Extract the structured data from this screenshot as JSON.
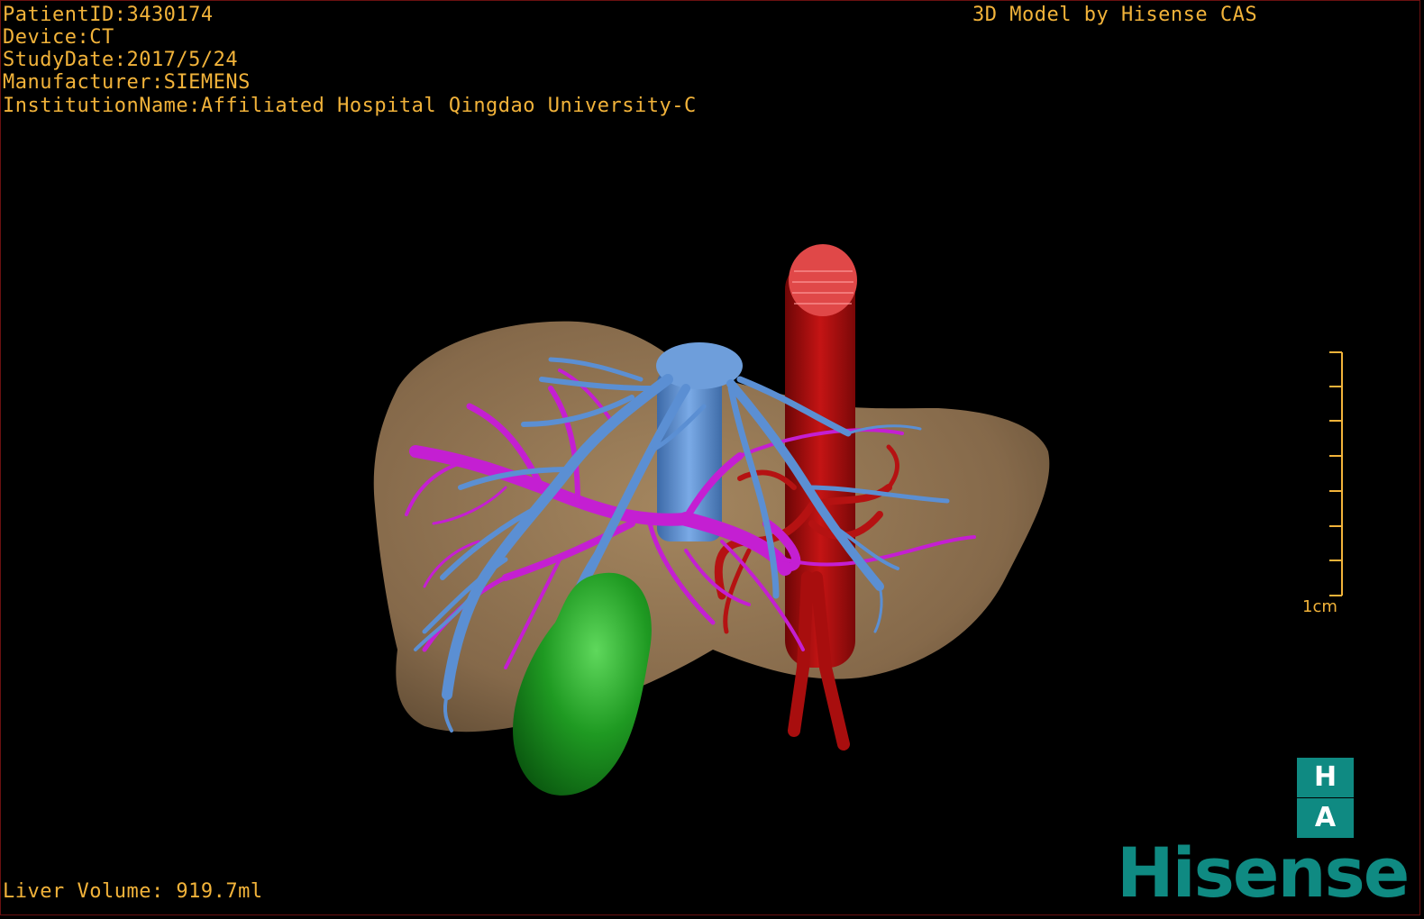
{
  "overlay": {
    "patient_id": "PatientID:3430174",
    "device": "Device:CT",
    "study_date": "StudyDate:2017/5/24",
    "manufacturer": "Manufacturer:SIEMENS",
    "institution": "InstitutionName:Affiliated Hospital Qingdao University-C",
    "credit": "3D Model by Hisense CAS",
    "liver_volume": "Liver Volume: 919.7ml"
  },
  "scale_bar": {
    "label": "1cm"
  },
  "badge": {
    "top": "H",
    "bottom": "A"
  },
  "brand": {
    "name": "Hisense"
  },
  "colors": {
    "text": "#f2b33a",
    "liver": "#8a6f4e",
    "portal_vein": "#c21fd0",
    "hepatic_vein": "#5a8fd2",
    "artery_ivc": "#b01010",
    "gallbladder": "#1e9a24",
    "brand": "#0f8a82"
  },
  "icons": {
    "badge": "ha-badge-icon",
    "brand": "hisense-logo-icon"
  }
}
